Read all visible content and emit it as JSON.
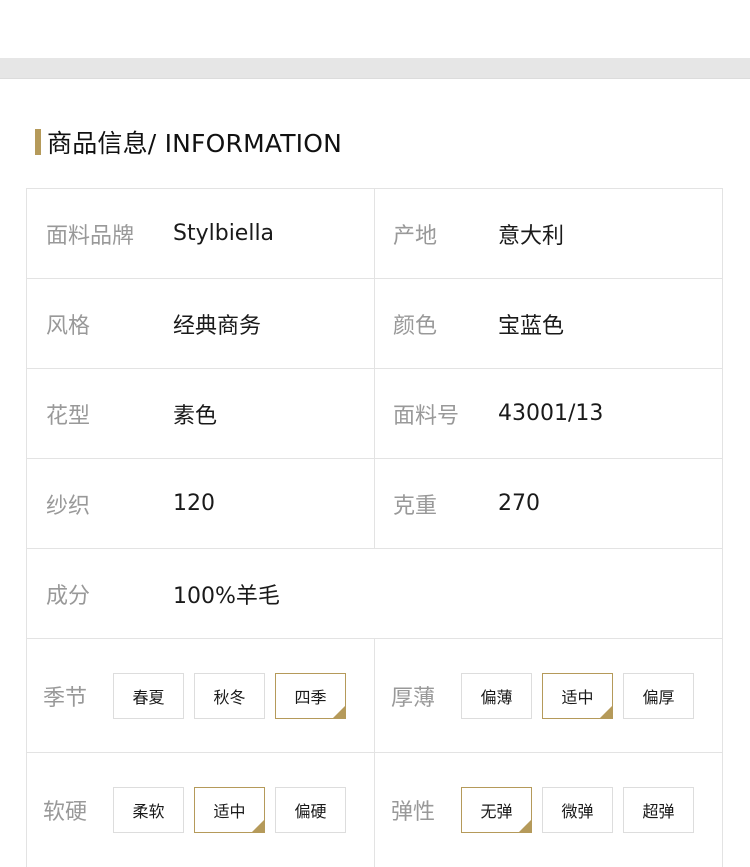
{
  "section": {
    "title": "商品信息/ INFORMATION",
    "accent_color": "#b59a5a"
  },
  "specs": [
    {
      "left": {
        "label": "面料品牌",
        "value": "Stylbiella"
      },
      "right": {
        "label": "产地",
        "value": "意大利"
      }
    },
    {
      "left": {
        "label": "风格",
        "value": "经典商务"
      },
      "right": {
        "label": "颜色",
        "value": "宝蓝色"
      }
    },
    {
      "left": {
        "label": "花型",
        "value": "素色"
      },
      "right": {
        "label": "面料号",
        "value": "43001/13"
      }
    },
    {
      "left": {
        "label": "纱织",
        "value": "120"
      },
      "right": {
        "label": "克重",
        "value": "270"
      }
    },
    {
      "left": {
        "label": "成分",
        "value": "100%羊毛"
      }
    }
  ],
  "options": [
    {
      "left": {
        "label": "季节",
        "options": [
          "春夏",
          "秋冬",
          "四季"
        ],
        "selected": "四季"
      },
      "right": {
        "label": "厚薄",
        "options": [
          "偏薄",
          "适中",
          "偏厚"
        ],
        "selected": "适中"
      }
    },
    {
      "left": {
        "label": "软硬",
        "options": [
          "柔软",
          "适中",
          "偏硬"
        ],
        "selected": "适中"
      },
      "right": {
        "label": "弹性",
        "options": [
          "无弹",
          "微弹",
          "超弹"
        ],
        "selected": "无弹"
      }
    }
  ]
}
